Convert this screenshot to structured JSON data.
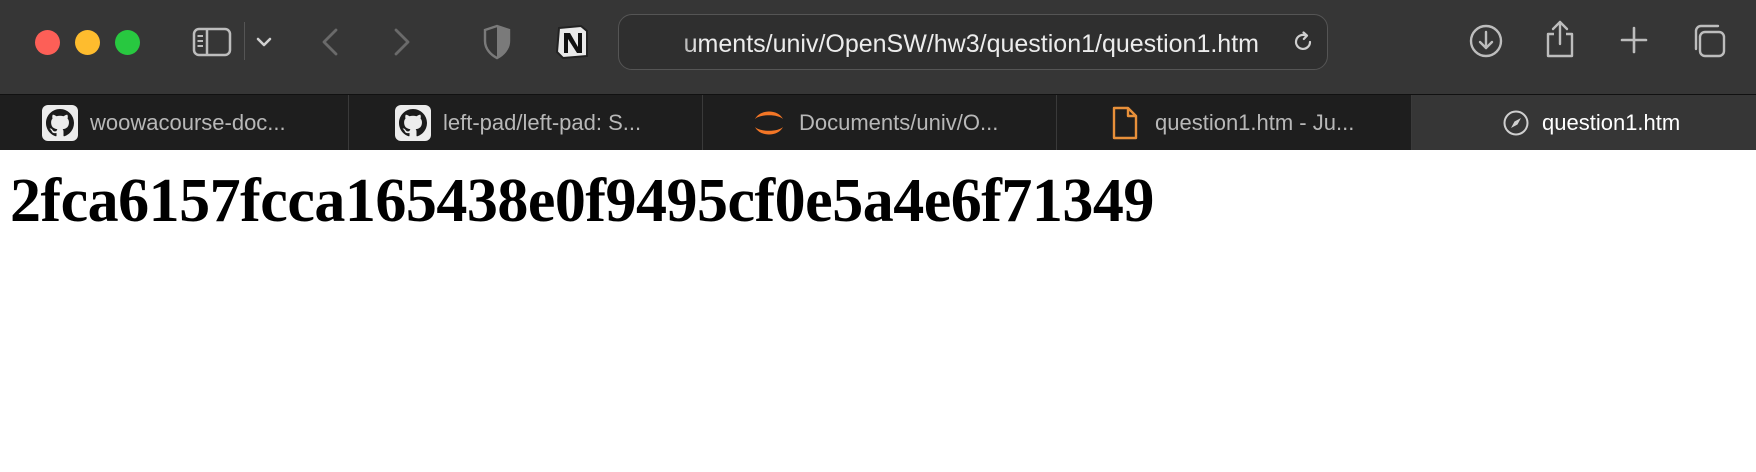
{
  "window": {
    "traffic_lights": {
      "close": "#fd5f57",
      "minimize": "#febc2e",
      "zoom": "#28c840"
    }
  },
  "toolbar": {
    "icons": [
      "sidebar-icon",
      "chevron-down-icon",
      "back-icon",
      "forward-icon",
      "shield-icon",
      "notion-icon",
      "reload-icon",
      "download-icon",
      "share-icon",
      "plus-icon",
      "tabs-overview-icon"
    ],
    "address_text": "uments/univ/OpenSW/hw3/question1/question1.htm"
  },
  "tabs": [
    {
      "label": "woowacourse-doc...",
      "icon": "github-icon",
      "active": false
    },
    {
      "label": "left-pad/left-pad: S...",
      "icon": "github-icon",
      "active": false
    },
    {
      "label": "Documents/univ/O...",
      "icon": "jupyter-icon",
      "active": false
    },
    {
      "label": "question1.htm - Ju...",
      "icon": "file-icon",
      "active": false
    },
    {
      "label": "question1.htm",
      "icon": "compass-icon",
      "active": true
    }
  ],
  "page": {
    "heading": "2fca6157fcca165438e0f9495cf0e5a4e6f71349"
  },
  "colors": {
    "toolbar_bg": "#363636",
    "tabbar_bg": "#1e1e1e",
    "jupyter_orange": "#f37626",
    "file_orange": "#e8903a"
  }
}
